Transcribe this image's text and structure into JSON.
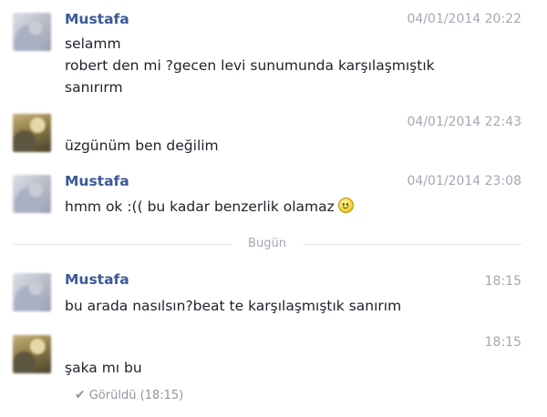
{
  "messages": [
    {
      "sender": "Mustafa",
      "timestamp": "04/01/2014 20:22",
      "lines": [
        "selamm",
        "robert den mi ?gecen levi sunumunda karşılaşmıştık",
        "sanırırm"
      ]
    },
    {
      "sender": "",
      "timestamp": "04/01/2014 22:43",
      "lines": [
        "üzgünüm ben değilim"
      ]
    },
    {
      "sender": "Mustafa",
      "timestamp": "04/01/2014 23:08",
      "lines": [
        "hmm ok :(( bu kadar benzerlik olamaz"
      ],
      "emoji": "smiley-icon"
    },
    {
      "sender": "Mustafa",
      "timestamp": "18:15",
      "lines": [
        "bu arada nasılsın?beat te karşılaşmıştık sanırım"
      ]
    },
    {
      "sender": "",
      "timestamp": "18:15",
      "lines": [
        "şaka mı bu"
      ]
    }
  ],
  "divider": {
    "label": "Bugün"
  },
  "seen": {
    "icon": "checkmark-icon",
    "text": "Görüldü (18:15)"
  },
  "colors": {
    "sender": "#3b5998",
    "meta": "#a4a8b2",
    "text": "#1d2129"
  }
}
